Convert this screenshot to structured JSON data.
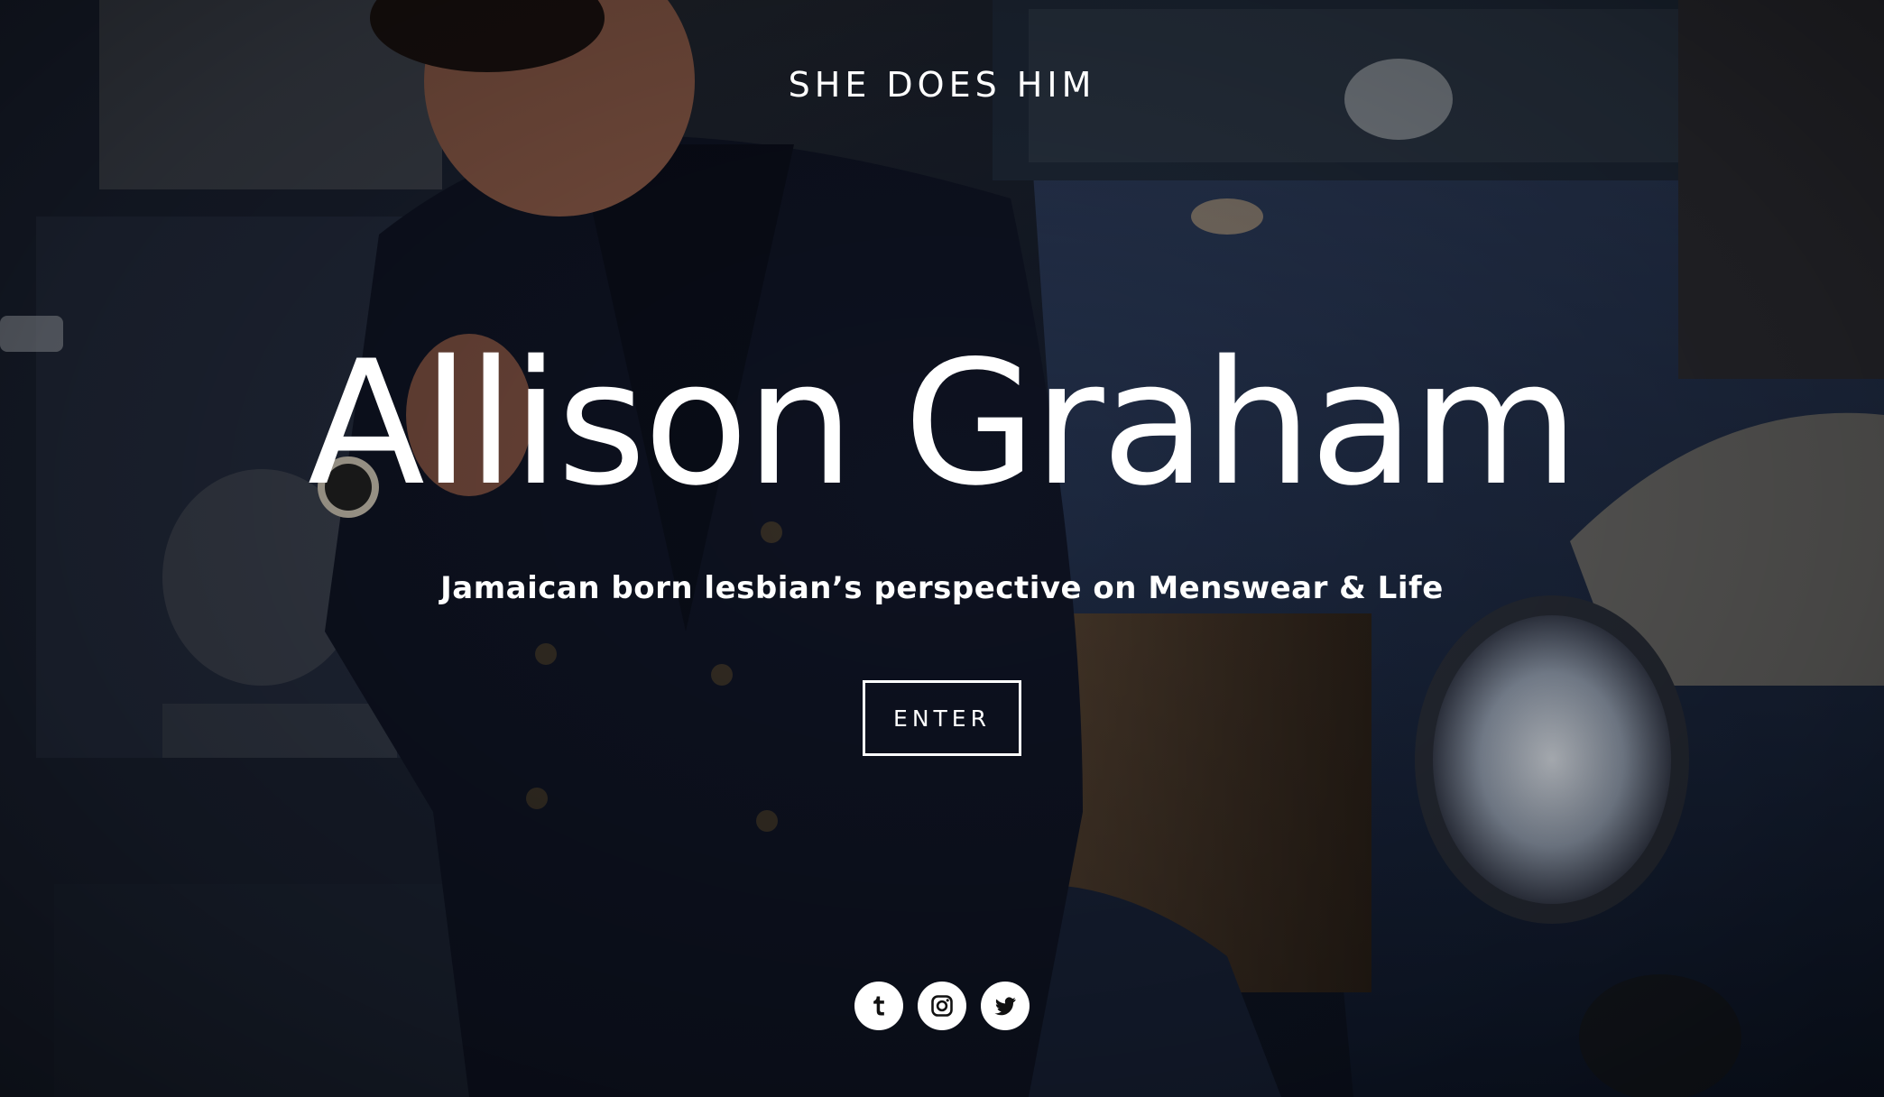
{
  "site": {
    "title": "SHE DOES HIM"
  },
  "hero": {
    "headline": "Allison Graham",
    "tagline": "Jamaican born lesbian’s perspective on Menswear & Life",
    "enter_label": "ENTER"
  },
  "social": {
    "items": [
      {
        "name": "tumblr",
        "icon": "tumblr-icon"
      },
      {
        "name": "instagram",
        "icon": "instagram-icon"
      },
      {
        "name": "twitter",
        "icon": "twitter-icon"
      }
    ]
  },
  "colors": {
    "text": "#ffffff",
    "icon_fg": "#111111",
    "icon_bg": "#ffffff"
  }
}
